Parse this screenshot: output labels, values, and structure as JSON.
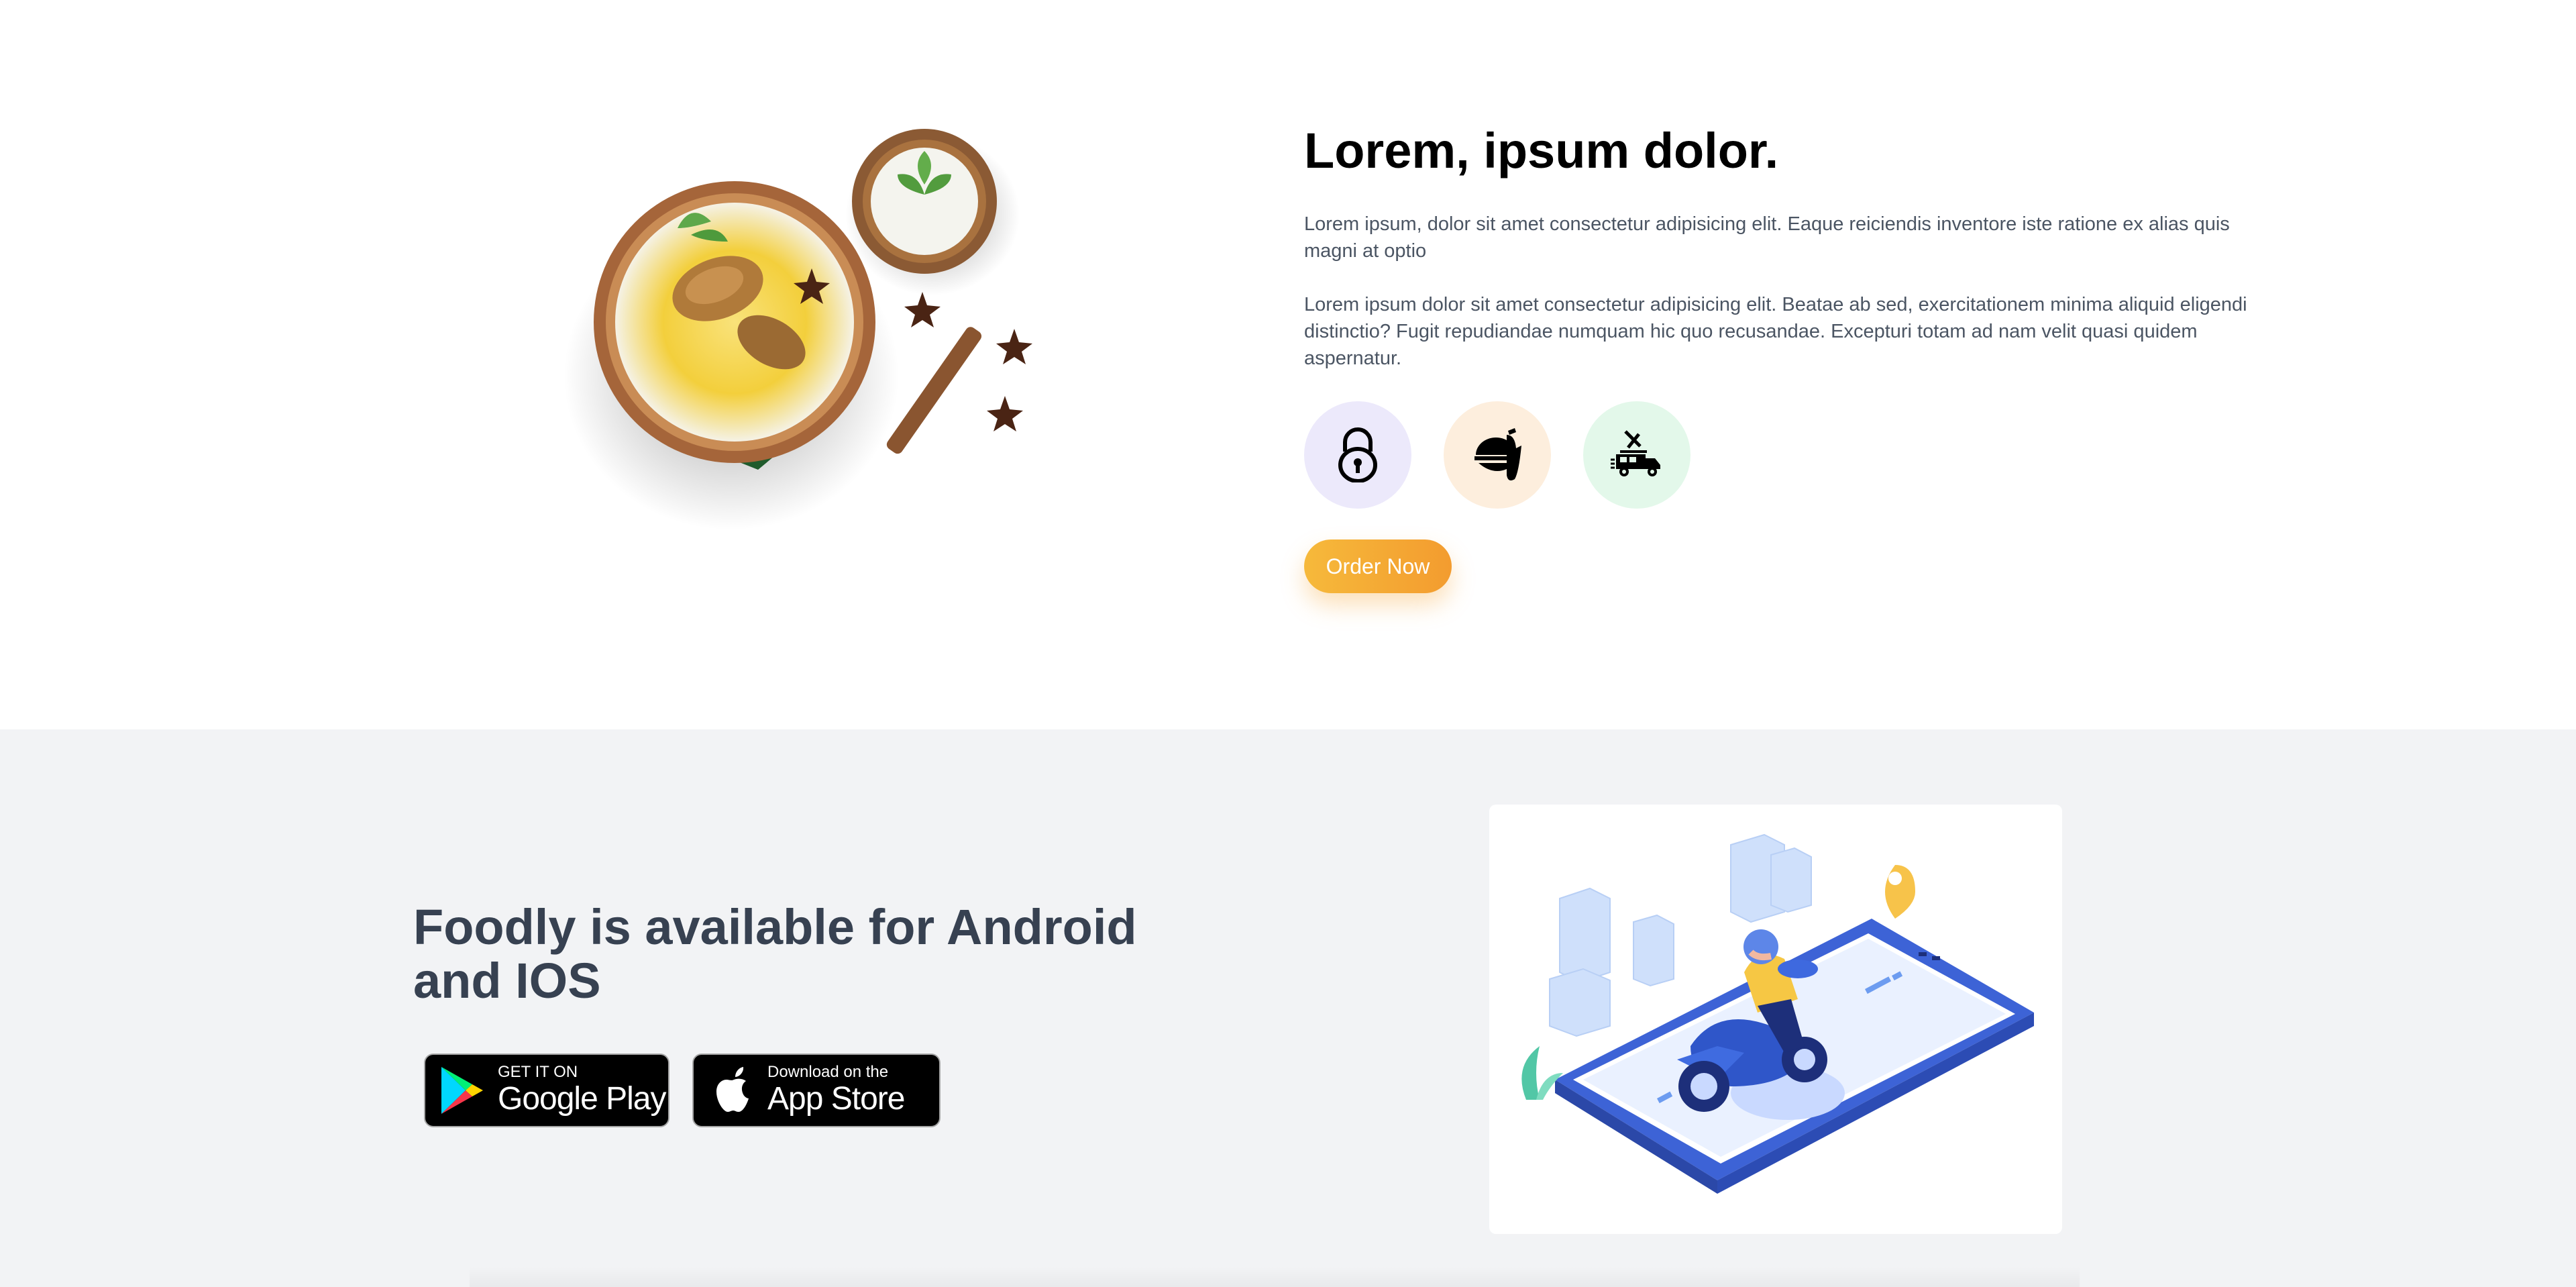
{
  "about": {
    "image_alt": "biryani-plate",
    "title": "Lorem, ipsum dolor.",
    "paragraph_1": "Lorem ipsum, dolor sit amet consectetur adipisicing elit. Eaque reiciendis inventore iste ratione ex alias quis magni at optio",
    "paragraph_2": "Lorem ipsum dolor sit amet consectetur adipisicing elit. Beatae ab sed, exercitationem minima aliquid eligendi distinctio? Fugit repudiandae numquam hic quo recusandae. Excepturi totam ad nam velit quasi quidem aspernatur.",
    "features": [
      {
        "icon": "lock-icon",
        "bg": "#ece9fb"
      },
      {
        "icon": "food-bowl-icon",
        "bg": "#fdeedd"
      },
      {
        "icon": "delivery-truck-icon",
        "bg": "#e3f8ea"
      }
    ],
    "order_button": "Order Now",
    "accent": "#f6b93b"
  },
  "app": {
    "title": "Foodly is available for Android and IOS",
    "google_play": {
      "small": "GET IT ON",
      "big": "Google Play"
    },
    "app_store": {
      "small": "Download on the",
      "big": "App Store"
    },
    "illustration_alt": "scooter-delivery-on-phone",
    "background": "#f2f3f5"
  }
}
